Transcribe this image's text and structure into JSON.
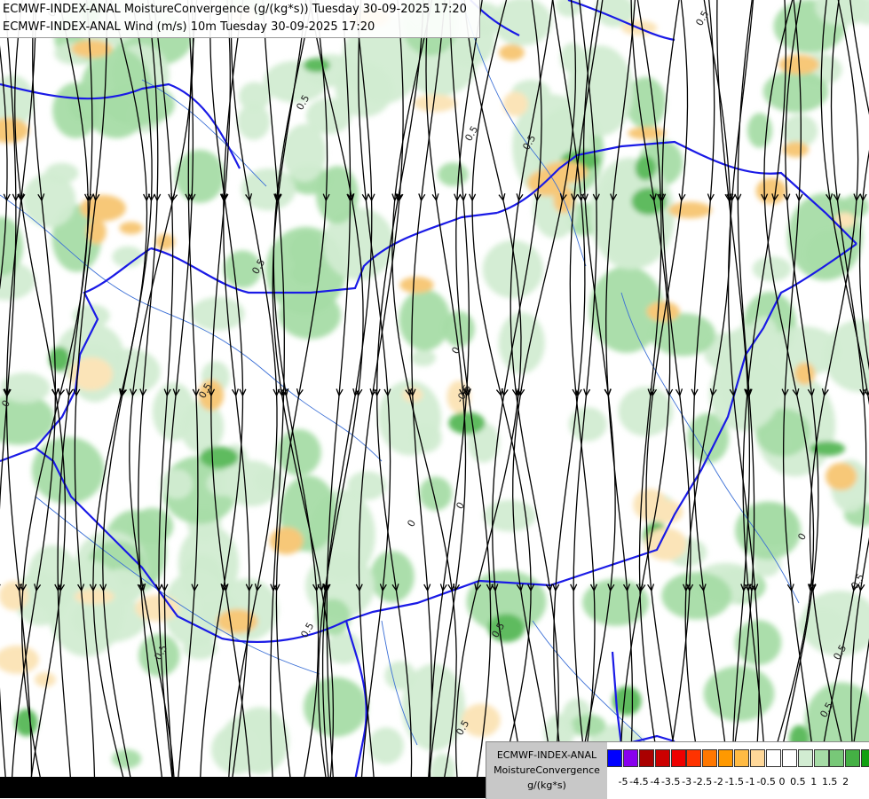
{
  "titles": {
    "line1": "ECMWF-INDEX-ANAL MoistureConvergence (g/(kg*s)) Tuesday 30-09-2025 17:20",
    "line2": "ECMWF-INDEX-ANAL Wind (m/s) 10m Tuesday 30-09-2025 17:20"
  },
  "legend": {
    "label1": "ECMWF-INDEX-ANAL",
    "label2": "MoistureConvergence",
    "label3": "g/(kg*s)",
    "colors": [
      "#0000ff",
      "#8800ee",
      "#aa0000",
      "#cc0000",
      "#ee0000",
      "#ff3300",
      "#ff7700",
      "#ff9900",
      "#ffbb44",
      "#ffd899",
      "#ffffff",
      "#ffffff",
      "#d2ecd2",
      "#a6dca6",
      "#78c878",
      "#44b044",
      "#11a011"
    ],
    "tick_labels": [
      "-5",
      "-4.5",
      "-4",
      "-3.5",
      "-3",
      "-2.5",
      "-2",
      "-1.5",
      "-1",
      "-0.5",
      "0",
      "0.5",
      "1",
      "1.5",
      "2"
    ]
  },
  "map": {
    "colors": {
      "conv_light": "#d2ecd2",
      "conv_mid": "#a6dca6",
      "conv_strong": "#5fbb5f",
      "div_light": "#fbe4b8",
      "div_mid": "#f7c878",
      "border": "#1a1ae6",
      "river": "#3b6fd6",
      "streamline": "#000000",
      "contour": "#222222"
    },
    "contour_labels": [
      "0.5",
      "-0.5",
      "0"
    ]
  }
}
